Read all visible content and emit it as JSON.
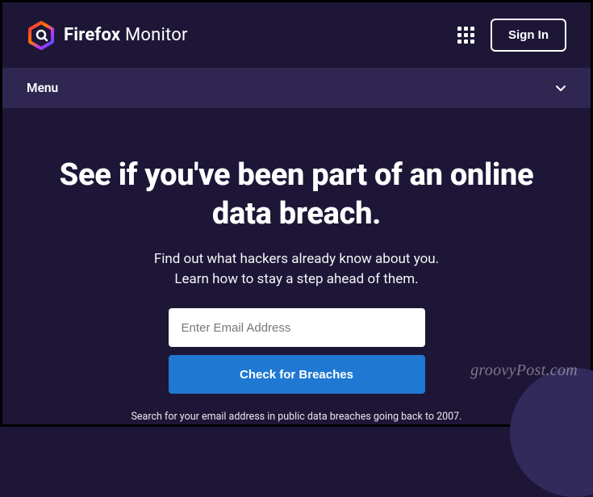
{
  "header": {
    "brand_bold": "Firefox",
    "brand_light": "Monitor",
    "sign_in_label": "Sign In"
  },
  "menu": {
    "label": "Menu"
  },
  "hero": {
    "title": "See if you've been part of an online data breach.",
    "subtitle": "Find out what hackers already know about you.\nLearn how to stay a step ahead of them."
  },
  "form": {
    "email_placeholder": "Enter Email Address",
    "check_label": "Check for Breaches",
    "small_print": "Search for your email address in public data breaches going back to 2007."
  },
  "watermark": "groovyPost.com"
}
